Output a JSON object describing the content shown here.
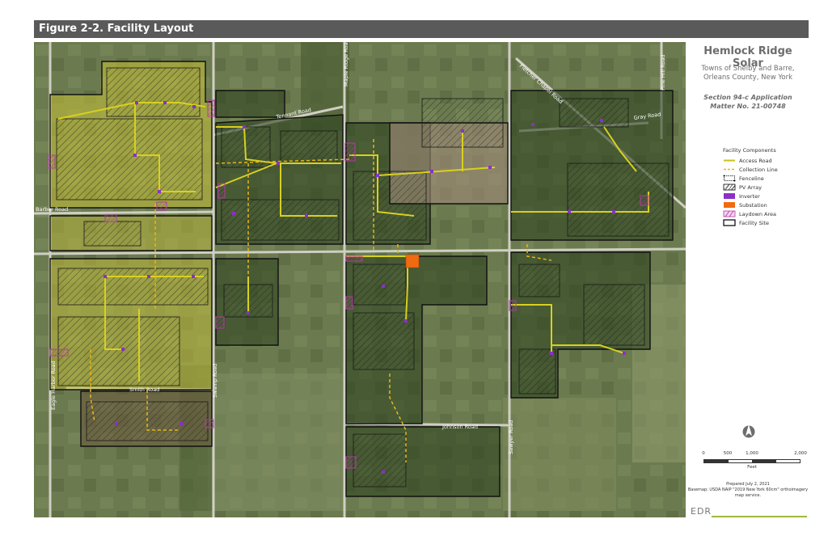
{
  "figure": {
    "title": "Figure 2-2. Facility Layout"
  },
  "project": {
    "title": "Hemlock Ridge Solar",
    "subtitle": "Towns of Shelby and Barre, Orleans County, New York",
    "application_line1": "Section 94-c Application",
    "application_line2": "Matter No. 21-00748"
  },
  "legend": {
    "title": "Facility Components",
    "items": [
      {
        "label": "Access Road",
        "symbol": "access-road",
        "color": "#c9c21e"
      },
      {
        "label": "Collection Line",
        "symbol": "collection-line",
        "color": "#e8b419"
      },
      {
        "label": "Fenceline",
        "symbol": "fenceline",
        "color": "#000000"
      },
      {
        "label": "PV Array",
        "symbol": "pv-array",
        "color": "#000000"
      },
      {
        "label": "Inverter",
        "symbol": "inverter",
        "color": "#8b2fc9"
      },
      {
        "label": "Substation",
        "symbol": "substation",
        "color": "#f06a12"
      },
      {
        "label": "Laydown Area",
        "symbol": "laydown-area",
        "color": "#b33aa5"
      },
      {
        "label": "Facility Site",
        "symbol": "facility-site",
        "color": "#000000"
      }
    ]
  },
  "scale_bar": {
    "ticks": [
      "0",
      "500",
      "1,000",
      "2,000"
    ],
    "unit": "Feet"
  },
  "credits": {
    "prepared": "Prepared July 2, 2021",
    "basemap": "Basemap: USDA NAIP \"2019 New York 60cm\" orthoimagery map service."
  },
  "logo": {
    "text": "EDR"
  },
  "roads": [
    {
      "label": "Tennant Road"
    },
    {
      "label": "Gray Road"
    },
    {
      "label": "Fletcher Chapel Road"
    },
    {
      "label": "Pine Hill Road"
    },
    {
      "label": "Maple Ridge Road"
    },
    {
      "label": "Barber Road"
    },
    {
      "label": "Eagle Harbor Road"
    },
    {
      "label": "Smith Road"
    },
    {
      "label": "Swamp Road"
    },
    {
      "label": "Johnson Road"
    },
    {
      "label": "Sawyer Road"
    }
  ],
  "colors": {
    "access_road": "#c9c21e",
    "collection_line": "#e8b419",
    "inverter": "#8b2fc9",
    "substation": "#f06a12",
    "laydown": "#b33aa5",
    "title_bar": "#5a5a5a"
  }
}
